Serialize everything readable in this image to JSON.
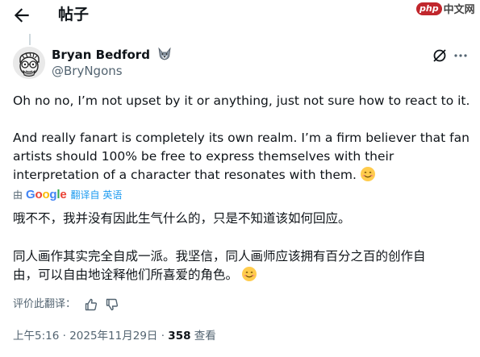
{
  "header": {
    "title": "帖子",
    "back_icon": "arrow-left-icon",
    "watermark_logo": "php",
    "watermark_text": "中文网"
  },
  "author": {
    "display_name": "Bryan Bedford",
    "handle": "@BryNgons",
    "badge_icon": "wolf-emoji-icon",
    "avatar_icon": "cartoon-avatar"
  },
  "actions": {
    "grok_icon": "grok-icon",
    "more_icon": "more-dots-icon"
  },
  "tweet": {
    "p1": "Oh no no, I’m not upset by it or anything, just not sure how to react to it.",
    "p2_line1": "And really fanart is completely its own realm. I’m a firm believer that fan",
    "p2_line2": "artists should 100% be free to express themselves with their",
    "p2_line3": "interpretation of a character that resonates with them.",
    "emoji": "smiling-face-emoji"
  },
  "translation": {
    "by_label": "由",
    "provider": "Google",
    "link_text": "翻译自 英语",
    "cn_p1": "哦不不，我并没有因此生气什么的，只是不知道该如何回应。",
    "cn_p2_line1": "同人画作其实完全自成一派。我坚信，同人画师应该拥有百分之百的创作自",
    "cn_p2_line2": "由，可以自由地诠释他们所喜爱的角色。",
    "rate_label": "评价此翻译："
  },
  "meta": {
    "time": "上午5:16",
    "separator": " · ",
    "date": "2025年11月29日",
    "views_count": "358",
    "views_label": "查看"
  }
}
